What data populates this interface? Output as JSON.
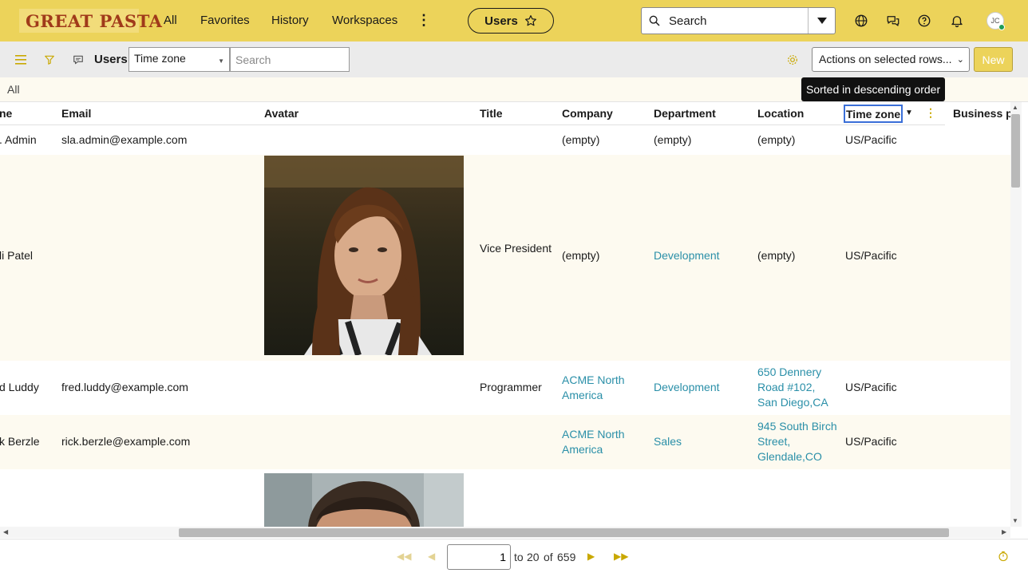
{
  "app": {
    "brand": "GREAT PASTA",
    "nav": [
      "All",
      "Favorites",
      "History",
      "Workspaces"
    ],
    "context_pill": "Users",
    "search_placeholder": "Search",
    "avatar_initials": "JC",
    "accent_color": "#ecd35a"
  },
  "list": {
    "title": "Users",
    "field_select": "Time zone",
    "search_placeholder": "Search",
    "actions_label": "Actions on selected rows...",
    "new_label": "New",
    "breadcrumb": "All",
    "tooltip": "Sorted in descending order"
  },
  "table": {
    "columns": [
      "ne",
      "Email",
      "Avatar",
      "Title",
      "Company",
      "Department",
      "Location",
      "Time zone",
      "Business p"
    ],
    "rows": [
      {
        "name": ". Admin",
        "email": "sla.admin@example.com",
        "title": "",
        "company": "(empty)",
        "department": "(empty)",
        "location": "(empty)",
        "timezone": "US/Pacific"
      },
      {
        "name": "li Patel",
        "email": "",
        "title": "Vice President",
        "company": "(empty)",
        "department": "Development",
        "location": "(empty)",
        "timezone": "US/Pacific"
      },
      {
        "name": "d Luddy",
        "email": "fred.luddy@example.com",
        "title": "Programmer",
        "company": "ACME North America",
        "department": "Development",
        "location": "650 Dennery Road #102, San Diego,CA",
        "timezone": "US/Pacific"
      },
      {
        "name": "k Berzle",
        "email": "rick.berzle@example.com",
        "title": "",
        "company": "ACME North America",
        "department": "Sales",
        "location": "945 South Birch Street, Glendale,CO",
        "timezone": "US/Pacific"
      }
    ]
  },
  "pagination": {
    "page": "1",
    "to": "to",
    "range_end": "20",
    "of": "of",
    "total": "659"
  }
}
